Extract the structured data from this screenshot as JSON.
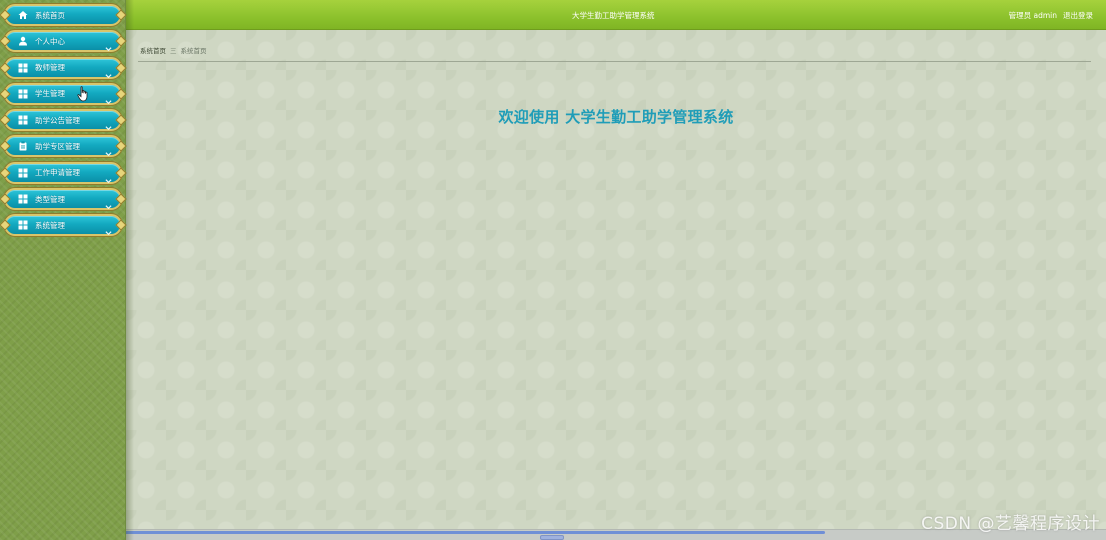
{
  "header": {
    "title": "大学生勤工助学管理系统",
    "user_label": "管理员 admin",
    "logout_label": "退出登录"
  },
  "sidebar": {
    "items": [
      {
        "label": "系统首页",
        "icon": "home-icon"
      },
      {
        "label": "个人中心",
        "icon": "user-icon"
      },
      {
        "label": "教师管理",
        "icon": "grid-icon"
      },
      {
        "label": "学生管理",
        "icon": "grid-icon"
      },
      {
        "label": "助学公告管理",
        "icon": "grid-icon"
      },
      {
        "label": "助学专区管理",
        "icon": "clipboard-icon"
      },
      {
        "label": "工作申请管理",
        "icon": "grid-icon"
      },
      {
        "label": "类型管理",
        "icon": "grid-icon"
      },
      {
        "label": "系统管理",
        "icon": "grid-icon"
      }
    ]
  },
  "breadcrumb": {
    "home": "系统首页",
    "separator": "三",
    "current": "系统首页"
  },
  "main": {
    "welcome": "欢迎使用 大学生勤工助学管理系统"
  },
  "watermark": "CSDN @艺馨程序设计",
  "colors": {
    "header": "#8cc12c",
    "sidebar": "#7f9f49",
    "menu_item": "#13a9c0",
    "welcome_text": "#1f9db8"
  }
}
